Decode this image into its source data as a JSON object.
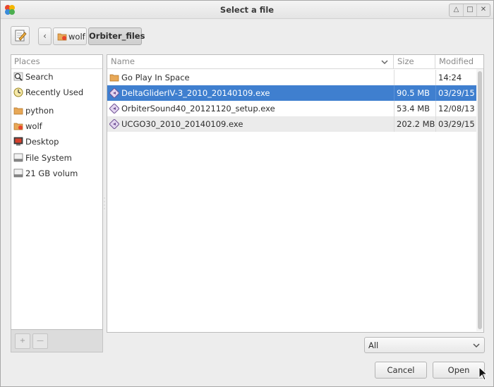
{
  "window": {
    "title": "Select a file"
  },
  "breadcrumb": {
    "items": [
      {
        "label": "wolf"
      },
      {
        "label": "Orbiter_files"
      }
    ]
  },
  "places": {
    "header": "Places",
    "items": [
      {
        "label": "Search",
        "icon": "search-icon"
      },
      {
        "label": "Recently Used",
        "icon": "clock-icon"
      },
      {
        "label": "python",
        "icon": "folder-icon"
      },
      {
        "label": "wolf",
        "icon": "home-folder-icon"
      },
      {
        "label": "Desktop",
        "icon": "desktop-icon"
      },
      {
        "label": "File System",
        "icon": "drive-icon"
      },
      {
        "label": "21 GB volum",
        "icon": "drive-icon"
      }
    ],
    "add_button": "+",
    "remove_button": "—"
  },
  "files": {
    "columns": {
      "name": "Name",
      "size": "Size",
      "modified": "Modified"
    },
    "rows": [
      {
        "name": "Go Play In Space",
        "size": "",
        "modified": "14:24",
        "icon": "folder-icon"
      },
      {
        "name": "DeltaGliderIV-3_2010_20140109.exe",
        "size": "90.5 MB",
        "modified": "03/29/15",
        "icon": "executable-icon",
        "selected": true
      },
      {
        "name": "OrbiterSound40_20121120_setup.exe",
        "size": "53.4 MB",
        "modified": "12/08/13",
        "icon": "executable-icon"
      },
      {
        "name": "UCGO30_2010_20140109.exe",
        "size": "202.2 MB",
        "modified": "03/29/15",
        "icon": "executable-icon"
      }
    ]
  },
  "filter": {
    "selected": "All"
  },
  "actions": {
    "cancel": "Cancel",
    "open": "Open"
  },
  "colors": {
    "selection": "#3f7fcf",
    "folder": "#e8a857"
  }
}
